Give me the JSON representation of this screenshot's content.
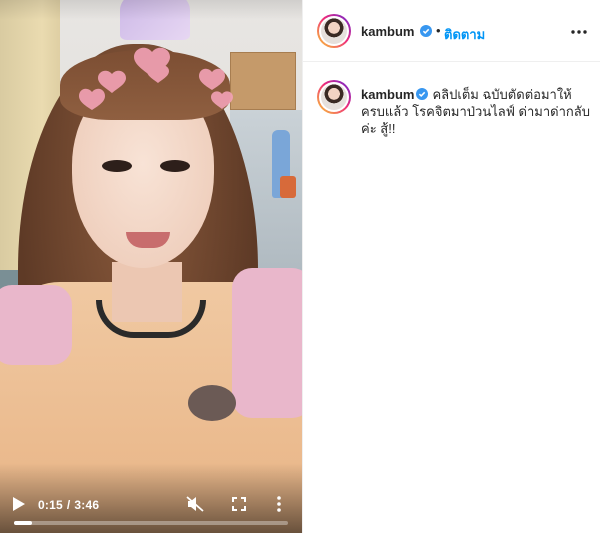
{
  "video": {
    "current_time": "0:15",
    "separator": "/",
    "duration": "3:46",
    "progress_fraction": 0.066,
    "icons": {
      "play": "play-icon",
      "mute": "muted-speaker-icon",
      "fullscreen": "fullscreen-icon",
      "more": "vertical-dots-icon"
    }
  },
  "post_header": {
    "username": "kambum",
    "verified": true,
    "dot": "•",
    "follow_label": "ติดตาม",
    "more_icon": "horizontal-dots-icon"
  },
  "caption": {
    "username": "kambum",
    "verified": true,
    "text": "คลิปเต็ม ฉบับตัดต่อมาให้ครบแล้ว โรคจิตมาป่วนไลฟ์ ด่ามาด่ากลับค่ะ สู้!!"
  },
  "colors": {
    "follow_blue": "#0095f6",
    "verified_blue": "#3897f0",
    "text": "#262626"
  }
}
